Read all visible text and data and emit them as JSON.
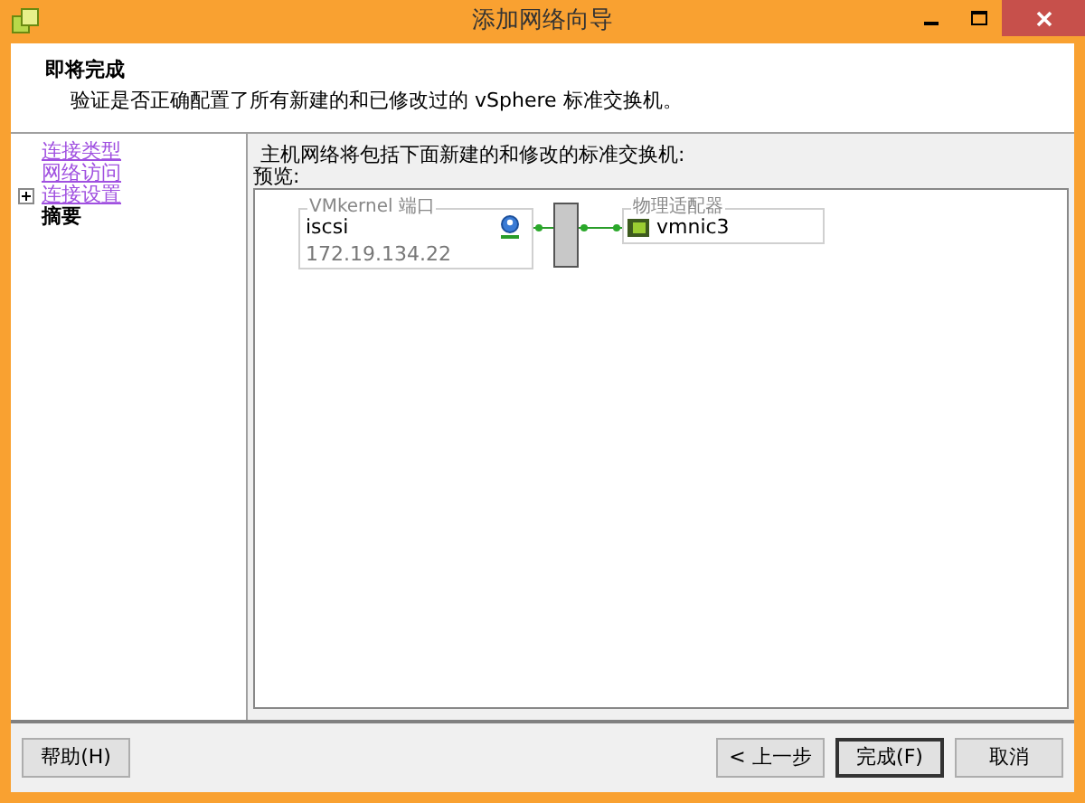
{
  "window": {
    "title": "添加网络向导"
  },
  "header": {
    "title": "即将完成",
    "subtitle": "验证是否正确配置了所有新建的和已修改过的 vSphere 标准交换机。"
  },
  "nav": [
    {
      "label": "连接类型",
      "selected": false,
      "expandable": false
    },
    {
      "label": "网络访问",
      "selected": false,
      "expandable": false
    },
    {
      "label": "连接设置",
      "selected": false,
      "expandable": true
    },
    {
      "label": "摘要",
      "selected": true,
      "expandable": false
    }
  ],
  "content": {
    "intro": "主机网络将包括下面新建的和修改的标准交换机:",
    "preview_label": "预览:",
    "port_group": {
      "legend": "VMkernel 端口",
      "name": "iscsi",
      "ip": "172.19.134.22"
    },
    "adapters": {
      "legend": "物理适配器",
      "items": [
        "vmnic3"
      ]
    }
  },
  "buttons": {
    "help": "帮助(H)",
    "back": "< 上一步",
    "finish": "完成(F)",
    "cancel": "取消"
  }
}
